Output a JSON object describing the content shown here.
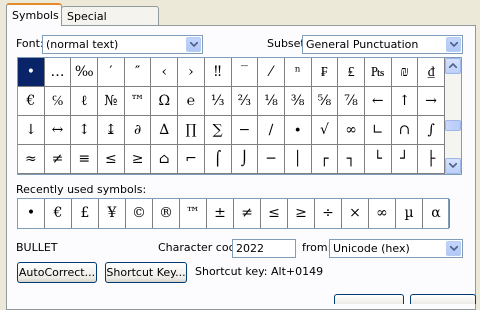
{
  "tabs": [
    {
      "label": "Symbols",
      "active": true
    },
    {
      "label": "Special Characters",
      "active": false
    }
  ],
  "font": {
    "label": "Font:",
    "value": "(normal text)"
  },
  "subset": {
    "label": "Subset:",
    "value": "General Punctuation"
  },
  "grid": [
    [
      "•",
      "…",
      "‰",
      "′",
      "″",
      "‹",
      "›",
      "‼",
      "‾",
      "⁄",
      "ⁿ",
      "₣",
      "₤",
      "₧",
      "₪",
      "₫"
    ],
    [
      "€",
      "℅",
      "ℓ",
      "№",
      "™",
      "Ω",
      "℮",
      "⅓",
      "⅔",
      "⅛",
      "⅜",
      "⅝",
      "⅞",
      "←",
      "↑",
      "→"
    ],
    [
      "↓",
      "↔",
      "↕",
      "↨",
      "∂",
      "∆",
      "∏",
      "∑",
      "−",
      "∕",
      "∙",
      "√",
      "∞",
      "∟",
      "∩",
      "∫"
    ],
    [
      "≈",
      "≠",
      "≡",
      "≤",
      "≥",
      "⌂",
      "⌐",
      "⌠",
      "⌡",
      "─",
      "│",
      "┌",
      "┐",
      "└",
      "┘",
      "├"
    ]
  ],
  "selected_symbol": "•",
  "recent": {
    "label": "Recently used symbols:",
    "symbols": [
      "•",
      "€",
      "£",
      "¥",
      "©",
      "®",
      "™",
      "±",
      "≠",
      "≤",
      "≥",
      "÷",
      "×",
      "∞",
      "µ",
      "α"
    ]
  },
  "char_name": "BULLET",
  "char_code": {
    "label": "Character code:",
    "value": "2022"
  },
  "from": {
    "label": "from:",
    "value": "Unicode (hex)"
  },
  "autocorrect_label": "AutoCorrect...",
  "shortcut_key_label": "Shortcut Key...",
  "shortcut_text": "Shortcut key: Alt+0149"
}
